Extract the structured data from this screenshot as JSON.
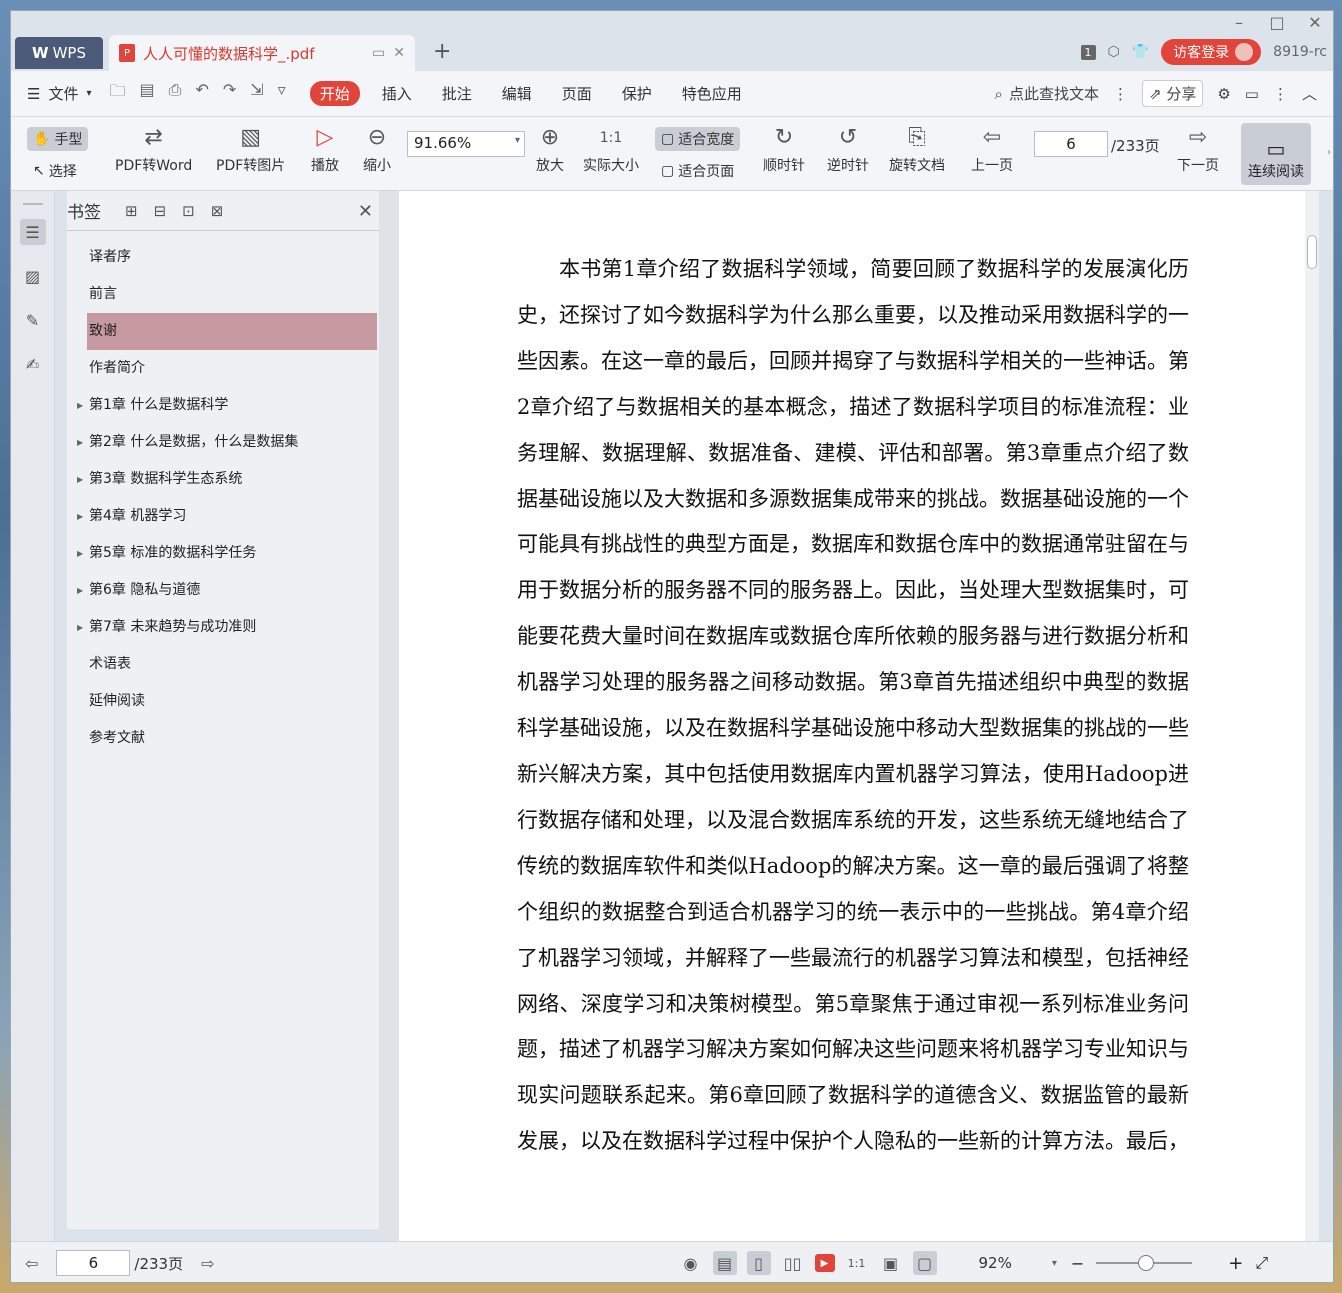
{
  "titlebar": {
    "wps_label": "WPS",
    "doc_tab_title": "人人可懂的数据科学_.pdf",
    "add_tab": "+",
    "page_badge": "1",
    "login_label": "访客登录",
    "user_id": "8919-rc"
  },
  "menubar": {
    "file_label": "文件",
    "tabs": [
      "开始",
      "插入",
      "批注",
      "编辑",
      "页面",
      "保护",
      "特色应用"
    ],
    "active_tab": "开始",
    "search_placeholder": "点此查找文本",
    "share_label": "分享"
  },
  "toolbar": {
    "hand_label": "手型",
    "select_label": "选择",
    "pdf_to_word": "PDF转Word",
    "pdf_to_image": "PDF转图片",
    "play_label": "播放",
    "zoom_out_label": "缩小",
    "zoom_value": "91.66%",
    "zoom_in_label": "放大",
    "actual_size_label": "实际大小",
    "fit_width_label": "适合宽度",
    "fit_page_label": "适合页面",
    "clockwise_label": "顺时针",
    "counterclockwise_label": "逆时针",
    "rotate_doc_label": "旋转文档",
    "prev_page_label": "上一页",
    "page_number": "6",
    "page_total": "/233页",
    "next_page_label": "下一页",
    "continuous_label": "连续阅读"
  },
  "bookmarks": {
    "title": "书签",
    "items": [
      {
        "label": "译者序",
        "expandable": false
      },
      {
        "label": "前言",
        "expandable": false
      },
      {
        "label": "致谢",
        "expandable": false,
        "selected": true
      },
      {
        "label": "作者简介",
        "expandable": false
      },
      {
        "label": "第1章 什么是数据科学",
        "expandable": true
      },
      {
        "label": "第2章 什么是数据，什么是数据集",
        "expandable": true
      },
      {
        "label": "第3章 数据科学生态系统",
        "expandable": true
      },
      {
        "label": "第4章 机器学习",
        "expandable": true
      },
      {
        "label": "第5章 标准的数据科学任务",
        "expandable": true
      },
      {
        "label": "第6章 隐私与道德",
        "expandable": true
      },
      {
        "label": "第7章 未来趋势与成功准则",
        "expandable": true
      },
      {
        "label": "术语表",
        "expandable": false
      },
      {
        "label": "延伸阅读",
        "expandable": false
      },
      {
        "label": "参考文献",
        "expandable": false
      }
    ]
  },
  "document": {
    "paragraph": "本书第1章介绍了数据科学领域，简要回顾了数据科学的发展演化历史，还探讨了如今数据科学为什么那么重要，以及推动采用数据科学的一些因素。在这一章的最后，回顾并揭穿了与数据科学相关的一些神话。第2章介绍了与数据相关的基本概念，描述了数据科学项目的标准流程：业务理解、数据理解、数据准备、建模、评估和部署。第3章重点介绍了数据基础设施以及大数据和多源数据集成带来的挑战。数据基础设施的一个可能具有挑战性的典型方面是，数据库和数据仓库中的数据通常驻留在与用于数据分析的服务器不同的服务器上。因此，当处理大型数据集时，可能要花费大量时间在数据库或数据仓库所依赖的服务器与进行数据分析和机器学习处理的服务器之间移动数据。第3章首先描述组织中典型的数据科学基础设施，以及在数据科学基础设施中移动大型数据集的挑战的一些新兴解决方案，其中包括使用数据库内置机器学习算法，使用Hadoop进行数据存储和处理，以及混合数据库系统的开发，这些系统无缝地结合了传统的数据库软件和类似Hadoop的解决方案。这一章的最后强调了将整个组织的数据整合到适合机器学习的统一表示中的一些挑战。第4章介绍了机器学习领域，并解释了一些最流行的机器学习算法和模型，包括神经网络、深度学习和决策树模型。第5章聚焦于通过审视一系列标准业务问题，描述了机器学习解决方案如何解决这些问题来将机器学习专业知识与现实问题联系起来。第6章回顾了数据科学的道德含义、数据监管的最新发展，以及在数据科学过程中保护个人隐私的一些新的计算方法。最后，"
  },
  "statusbar": {
    "page_number": "6",
    "page_total": "/233页",
    "zoom_value": "92%"
  },
  "colors": {
    "accent": "#e0443a",
    "selected_bookmark": "#c69aa0"
  }
}
